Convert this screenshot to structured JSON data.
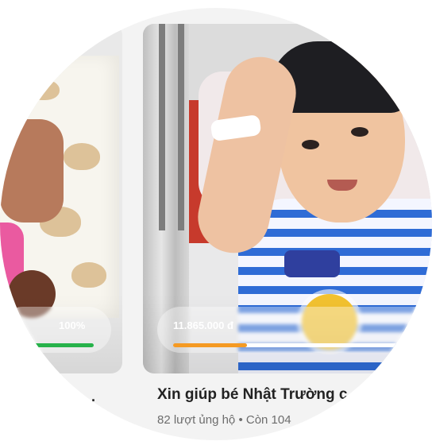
{
  "cards": [
    {
      "progress_label": "100%",
      "progress": 1.0,
      "progress_color": "#27b24a",
      "caption_fragment": "·"
    },
    {
      "amount_label": "11.865.000 đ",
      "progress": 0.25,
      "progress_color": "#f59a23",
      "title": "Xin giúp bé Nhật Trường c",
      "meta": "82 lượt ủng hộ • Còn 104"
    }
  ],
  "colors": {
    "background": "#f3f3f3",
    "title_text": "#222222",
    "meta_text": "#6d6d6d"
  }
}
